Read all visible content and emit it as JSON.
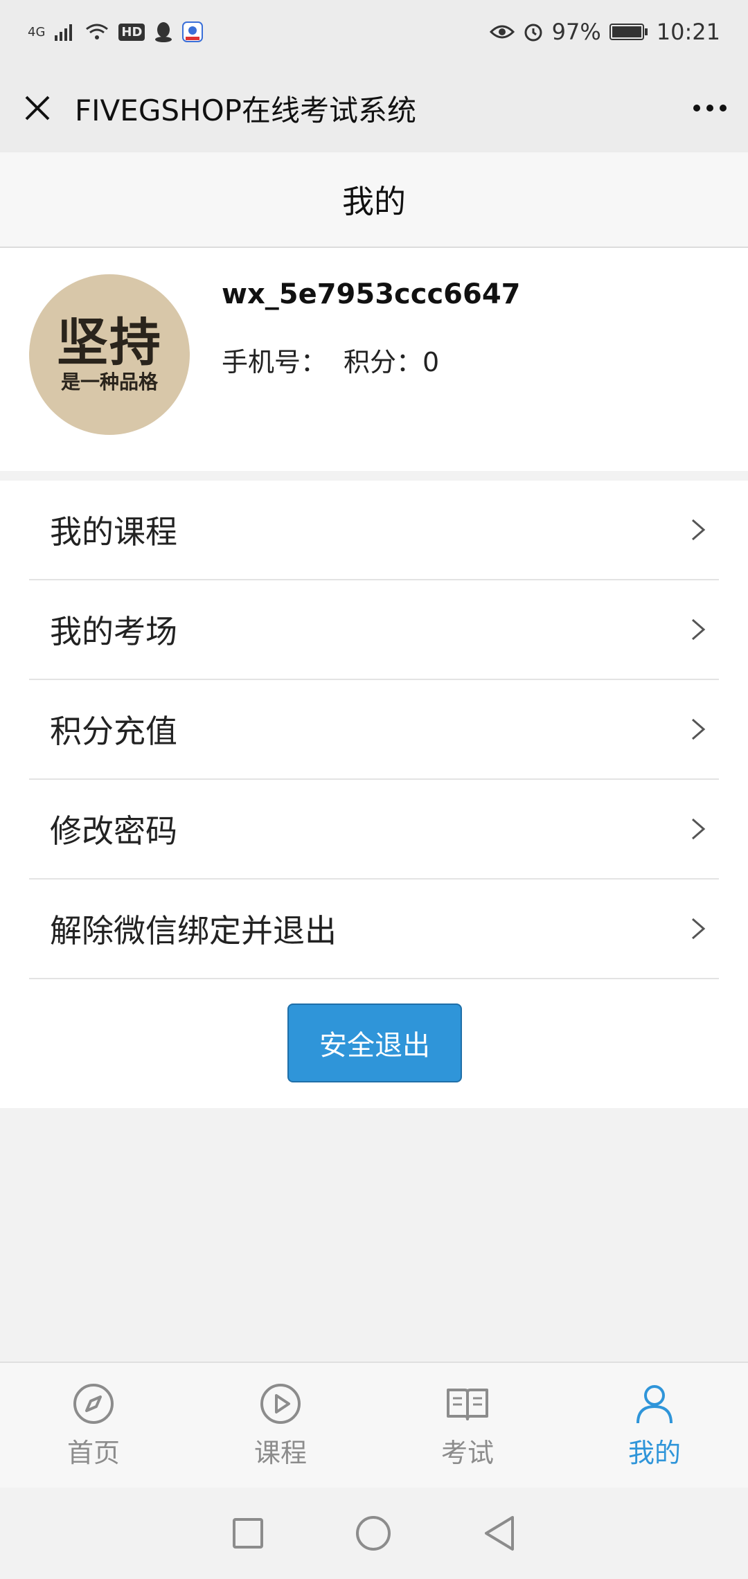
{
  "status_bar": {
    "network": "4G",
    "hd_badge": "HD",
    "battery": "97%",
    "time": "10:21"
  },
  "nav": {
    "title": "FIVEGSHOP在线考试系统"
  },
  "page": {
    "title": "我的"
  },
  "profile": {
    "avatar_text_line1": "坚持",
    "avatar_text_line2": "是一种品格",
    "username": "wx_5e7953ccc6647",
    "phone_label": "手机号：",
    "points_label": "积分：0"
  },
  "menu": {
    "items": [
      {
        "label": "我的课程"
      },
      {
        "label": "我的考场"
      },
      {
        "label": "积分充值"
      },
      {
        "label": "修改密码"
      },
      {
        "label": "解除微信绑定并退出"
      }
    ],
    "logout_label": "安全退出"
  },
  "tabs": [
    {
      "label": "首页",
      "icon": "compass-icon"
    },
    {
      "label": "课程",
      "icon": "play-circle-icon"
    },
    {
      "label": "考试",
      "icon": "book-icon"
    },
    {
      "label": "我的",
      "icon": "user-icon",
      "active": true
    }
  ],
  "colors": {
    "accent": "#2f95d9",
    "tab_inactive": "#8c8c8c"
  }
}
